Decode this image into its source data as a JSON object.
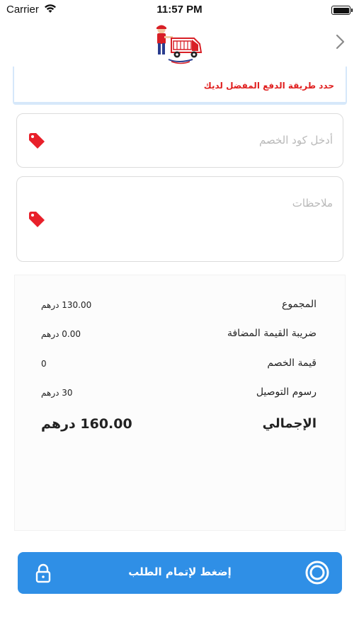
{
  "status_bar": {
    "carrier": "Carrier",
    "time": "11:57 PM",
    "wifi_icon": "wifi-icon",
    "battery_icon": "battery-icon"
  },
  "nav": {
    "logo_icon": "delivery-cart-logo",
    "back_icon": "chevron-right-icon"
  },
  "payment": {
    "hint": "حدد طريقة الدفع المفضل لديك",
    "hint_color": "#e02020"
  },
  "discount": {
    "placeholder": "أدخل كود الخصم",
    "icon": "tag-icon"
  },
  "notes": {
    "placeholder": "ملاحظات",
    "icon": "tag-icon"
  },
  "summary": {
    "rows": [
      {
        "label": "المجموع",
        "value": "130.00 درهم"
      },
      {
        "label": "ضريبة القيمة المضافة",
        "value": "0.00 درهم"
      },
      {
        "label": "قيمة الخصم",
        "value": "0"
      },
      {
        "label": "رسوم التوصيل",
        "value": "30 درهم"
      }
    ],
    "total": {
      "label": "الإجمالي",
      "value": "160.00 درهم"
    }
  },
  "checkout": {
    "label": "إضغط لإتمام الطلب",
    "color": "#2f8fe6",
    "lock_icon": "lock-icon",
    "radio_icon": "radio-selected-icon"
  }
}
